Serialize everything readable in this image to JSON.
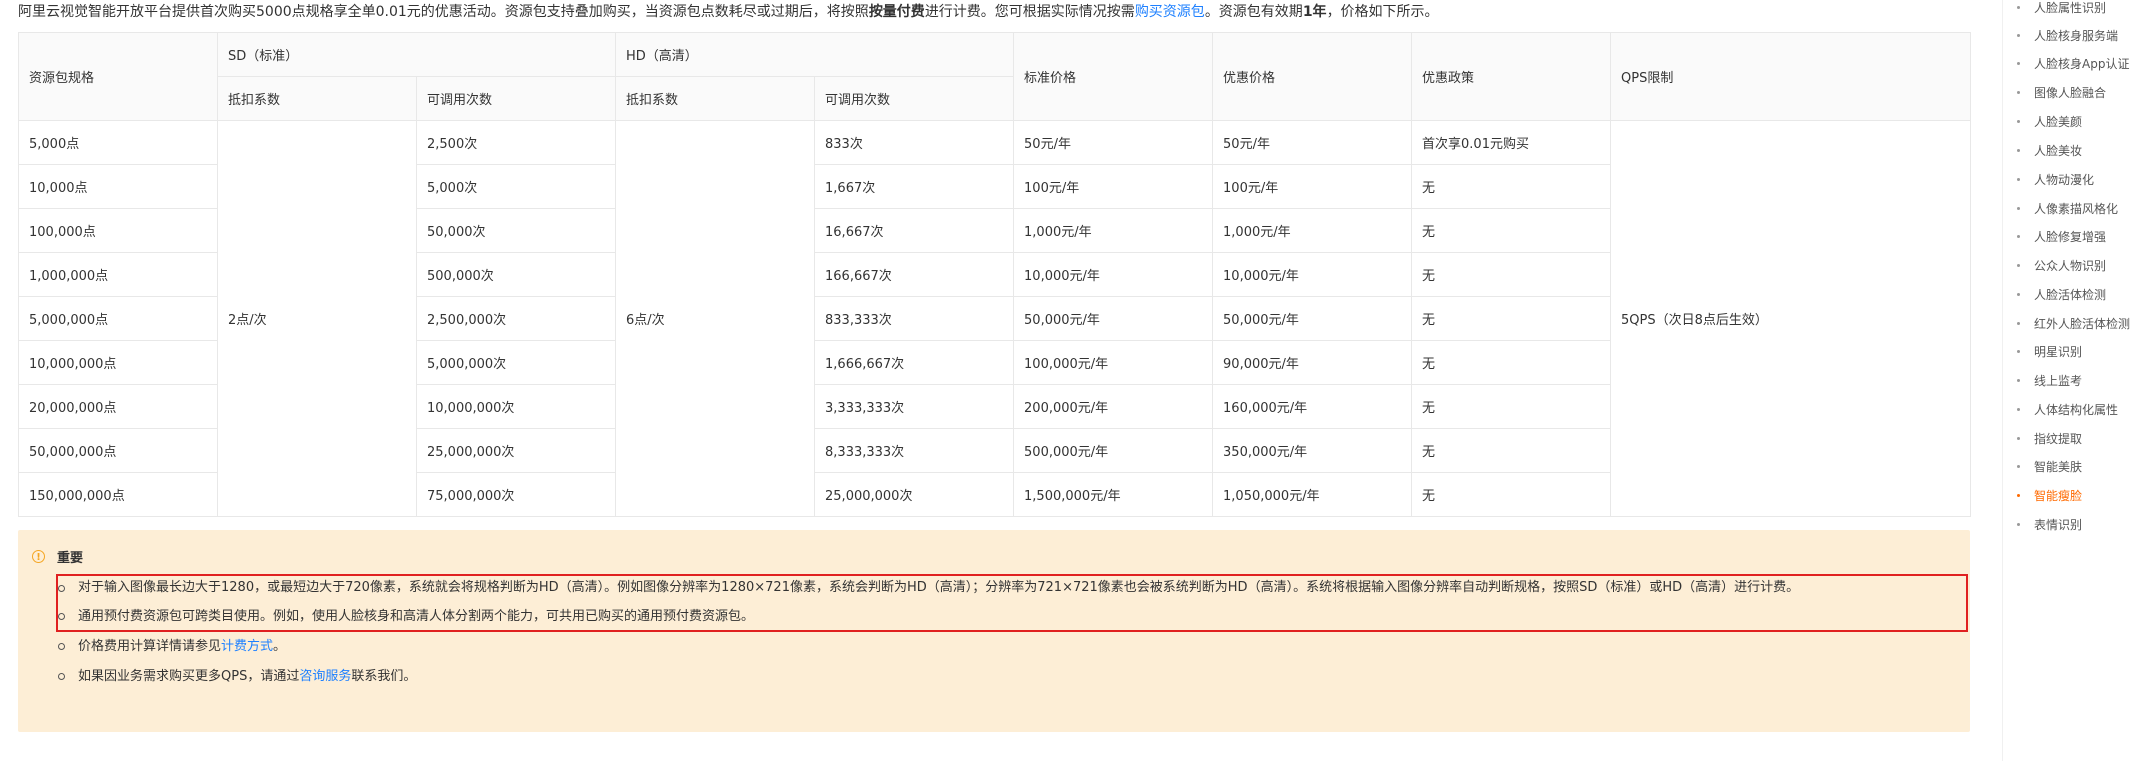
{
  "intro": {
    "part1": "阿里云视觉智能开放平台提供首次购买5000点规格享全单0.01元的优惠活动。资源包支持叠加购买，当资源包点数耗尽或过期后，将按照",
    "bold1": "按量付费",
    "part2": "进行计费。您可根据实际情况按需",
    "link": "购买资源包",
    "part3": "。资源包有效期",
    "bold2": "1年",
    "part4": "，价格如下所示。"
  },
  "table": {
    "headers": {
      "spec": "资源包规格",
      "sd": "SD（标准）",
      "hd": "HD（高清）",
      "sd_factor": "抵扣系数",
      "sd_calls": "可调用次数",
      "hd_factor": "抵扣系数",
      "hd_calls": "可调用次数",
      "std_price": "标准价格",
      "disc_price": "优惠价格",
      "policy": "优惠政策",
      "qps": "QPS限制"
    },
    "sd_factor_value": "2点/次",
    "hd_factor_value": "6点/次",
    "qps_value": "5QPS（次日8点后生效）",
    "rows": [
      {
        "spec": "5,000点",
        "sd_calls": "2,500次",
        "hd_calls": "833次",
        "std": "50元/年",
        "disc": "50元/年",
        "policy": "首次享0.01元购买"
      },
      {
        "spec": "10,000点",
        "sd_calls": "5,000次",
        "hd_calls": "1,667次",
        "std": "100元/年",
        "disc": "100元/年",
        "policy": "无"
      },
      {
        "spec": "100,000点",
        "sd_calls": "50,000次",
        "hd_calls": "16,667次",
        "std": "1,000元/年",
        "disc": "1,000元/年",
        "policy": "无"
      },
      {
        "spec": "1,000,000点",
        "sd_calls": "500,000次",
        "hd_calls": "166,667次",
        "std": "10,000元/年",
        "disc": "10,000元/年",
        "policy": "无"
      },
      {
        "spec": "5,000,000点",
        "sd_calls": "2,500,000次",
        "hd_calls": "833,333次",
        "std": "50,000元/年",
        "disc": "50,000元/年",
        "policy": "无"
      },
      {
        "spec": "10,000,000点",
        "sd_calls": "5,000,000次",
        "hd_calls": "1,666,667次",
        "std": "100,000元/年",
        "disc": "90,000元/年",
        "policy": "无"
      },
      {
        "spec": "20,000,000点",
        "sd_calls": "10,000,000次",
        "hd_calls": "3,333,333次",
        "std": "200,000元/年",
        "disc": "160,000元/年",
        "policy": "无"
      },
      {
        "spec": "50,000,000点",
        "sd_calls": "25,000,000次",
        "hd_calls": "8,333,333次",
        "std": "500,000元/年",
        "disc": "350,000元/年",
        "policy": "无"
      },
      {
        "spec": "150,000,000点",
        "sd_calls": "75,000,000次",
        "hd_calls": "25,000,000次",
        "std": "1,500,000元/年",
        "disc": "1,050,000元/年",
        "policy": "无"
      }
    ]
  },
  "notice": {
    "title": "重要",
    "item1": "对于输入图像最长边大于1280，或最短边大于720像素，系统就会将规格判断为HD（高清）。例如图像分辨率为1280×721像素，系统会判断为HD（高清）；分辨率为721×721像素也会被系统判断为HD（高清）。系统将根据输入图像分辨率自动判断规格，按照SD（标准）或HD（高清）进行计费。",
    "item2": "通用预付费资源包可跨类目使用。例如，使用人脸核身和高清人体分割两个能力，可共用已购买的通用预付费资源包。",
    "item3_pre": "价格费用计算详情请参见",
    "item3_link": "计费方式",
    "item3_post": "。",
    "item4_pre": "如果因业务需求购买更多QPS，请通过",
    "item4_link": "咨询服务",
    "item4_post": "联系我们。"
  },
  "sidebar": {
    "items": [
      {
        "label": "人脸属性识别",
        "active": false
      },
      {
        "label": "人脸核身服务端",
        "active": false
      },
      {
        "label": "人脸核身App认证",
        "active": false
      },
      {
        "label": "图像人脸融合",
        "active": false
      },
      {
        "label": "人脸美颜",
        "active": false
      },
      {
        "label": "人脸美妆",
        "active": false
      },
      {
        "label": "人物动漫化",
        "active": false
      },
      {
        "label": "人像素描风格化",
        "active": false
      },
      {
        "label": "人脸修复增强",
        "active": false
      },
      {
        "label": "公众人物识别",
        "active": false
      },
      {
        "label": "人脸活体检测",
        "active": false
      },
      {
        "label": "红外人脸活体检测",
        "active": false
      },
      {
        "label": "明星识别",
        "active": false
      },
      {
        "label": "线上监考",
        "active": false
      },
      {
        "label": "人体结构化属性",
        "active": false
      },
      {
        "label": "指纹提取",
        "active": false
      },
      {
        "label": "智能美肤",
        "active": false
      },
      {
        "label": "智能瘦脸",
        "active": true
      },
      {
        "label": "表情识别",
        "active": false
      }
    ]
  }
}
